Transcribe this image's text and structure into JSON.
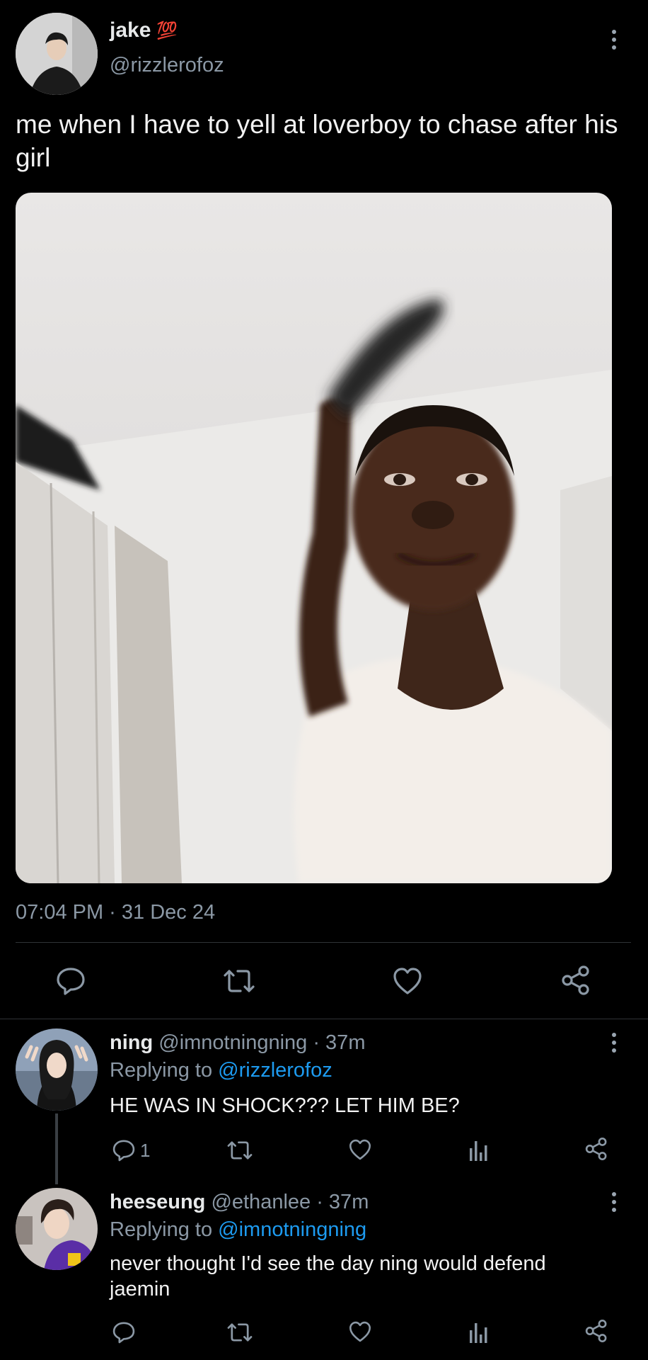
{
  "tweet": {
    "display_name": "jake",
    "badge_emoji": "💯",
    "handle": "@rizzlerofoz",
    "text": "me when I have to yell at loverboy to chase after his girl",
    "timestamp": "07:04 PM · 31 Dec 24",
    "actions": [
      "reply-icon",
      "retweet-icon",
      "like-icon",
      "share-icon"
    ]
  },
  "replies": [
    {
      "name": "ning",
      "handle": "@imnotningning",
      "time": "· 37m",
      "replying_prefix": "Replying to",
      "replying_to": "@rizzlerofoz",
      "text": "HE WAS IN SHOCK??? LET HIM BE?",
      "reply_count": "1"
    },
    {
      "name": "heeseung",
      "handle": "@ethanlee",
      "time": "· 37m",
      "replying_prefix": "Replying to",
      "replying_to": "@imnotningning",
      "text": "never thought I'd see the day ning would defend jaemin"
    }
  ],
  "colors": {
    "background": "#000000",
    "text": "#e7e9ea",
    "muted": "#8b98a5",
    "link": "#1d9bf0",
    "badge": "#e0245e"
  }
}
